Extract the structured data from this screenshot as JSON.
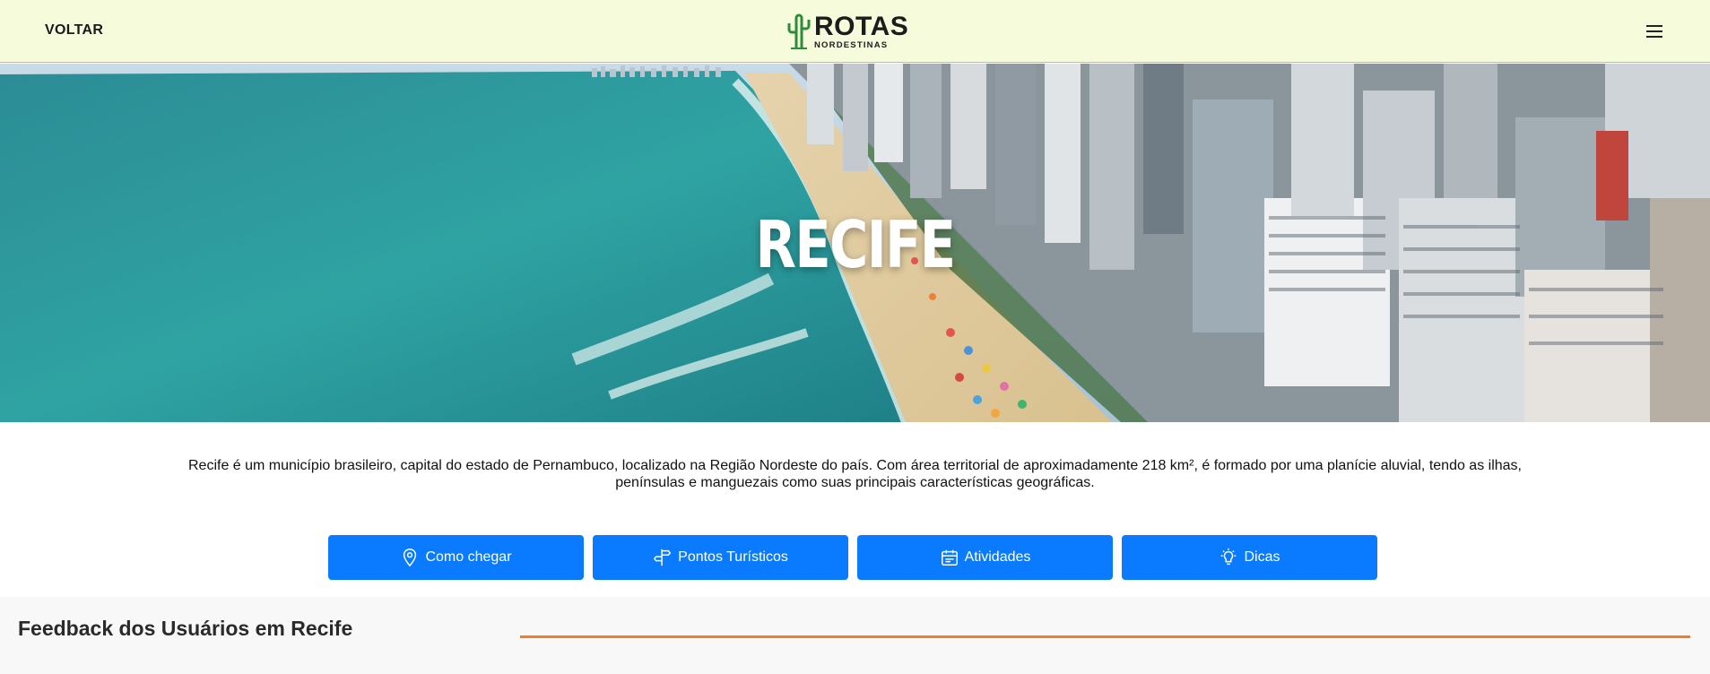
{
  "header": {
    "back_label": "VOLTAR",
    "logo_title": "ROTAS",
    "logo_subtitle": "NORDESTINAS",
    "logo_icon": "cactus-icon",
    "menu_icon": "hamburger-menu-icon"
  },
  "hero": {
    "title": "RECIFE"
  },
  "intro": {
    "text": "Recife é um município brasileiro, capital do estado de Pernambuco, localizado na Região Nordeste do país. Com área territorial de aproximadamente 218 km², é formado por uma planície aluvial, tendo as ilhas, penínsulas e manguezais como suas principais características geográficas."
  },
  "actions": [
    {
      "label": "Como chegar",
      "icon": "map-pin-icon"
    },
    {
      "label": "Pontos Turísticos",
      "icon": "signpost-icon"
    },
    {
      "label": "Atividades",
      "icon": "calendar-icon"
    },
    {
      "label": "Dicas",
      "icon": "lightbulb-icon"
    }
  ],
  "feedback": {
    "title": "Feedback dos Usuários em Recife"
  },
  "colors": {
    "header_bg": "#f6fbdc",
    "button_bg": "#0a7bff",
    "accent_rule": "#f07f2c",
    "logo_green": "#2f8a3a"
  }
}
